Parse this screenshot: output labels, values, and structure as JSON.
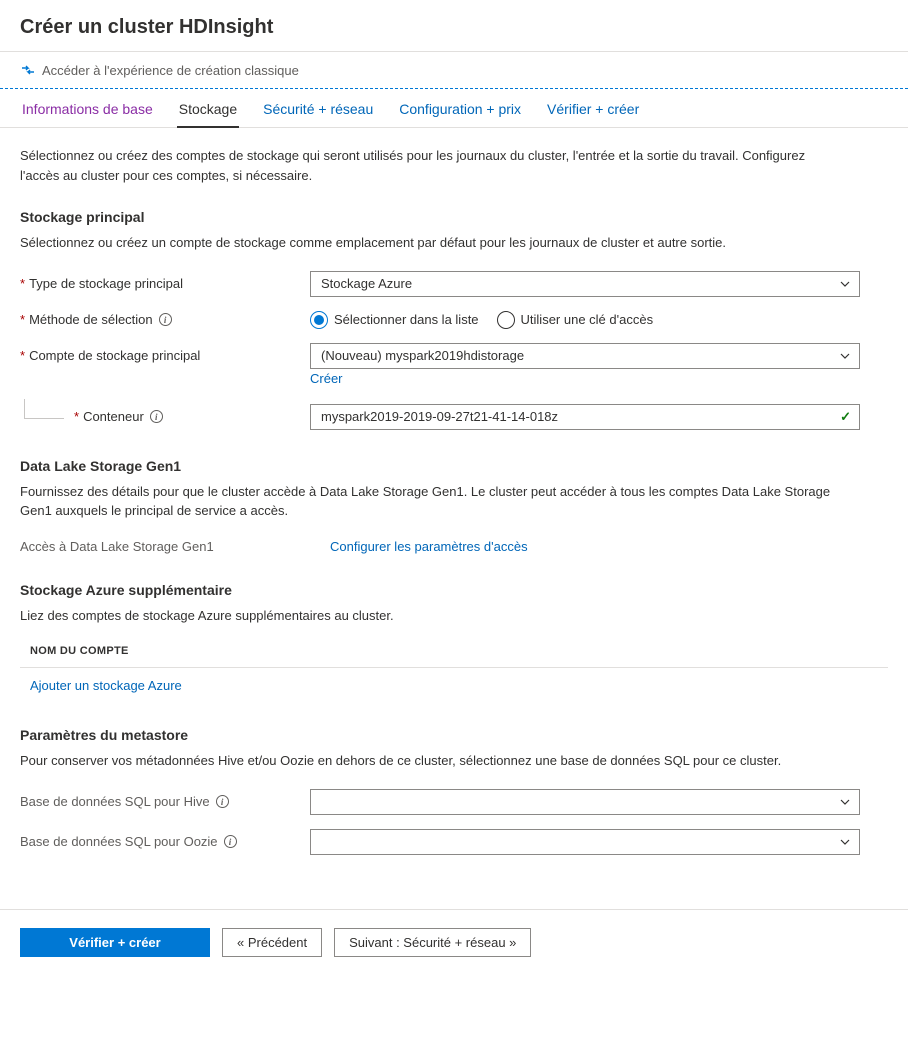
{
  "header": {
    "title": "Créer un cluster HDInsight"
  },
  "classic_link": {
    "text": "Accéder à l'expérience de création classique"
  },
  "tabs": [
    {
      "label": "Informations de base",
      "state": "visited"
    },
    {
      "label": "Stockage",
      "state": "active"
    },
    {
      "label": "Sécurité + réseau",
      "state": "link"
    },
    {
      "label": "Configuration + prix",
      "state": "link"
    },
    {
      "label": "Vérifier + créer",
      "state": "link"
    }
  ],
  "intro": "Sélectionnez ou créez des comptes de stockage qui seront utilisés pour les journaux du cluster, l'entrée et la sortie du travail. Configurez l'accès au cluster pour ces comptes, si nécessaire.",
  "primary_storage": {
    "title": "Stockage principal",
    "desc": "Sélectionnez ou créez un compte de stockage comme emplacement par défaut pour les journaux de cluster et autre sortie.",
    "type_label": "Type de stockage principal",
    "type_value": "Stockage Azure",
    "method_label": "Méthode de sélection",
    "method_options": [
      {
        "label": "Sélectionner dans la liste",
        "checked": true
      },
      {
        "label": "Utiliser une clé d'accès",
        "checked": false
      }
    ],
    "account_label": "Compte de stockage principal",
    "account_value": "(Nouveau) myspark2019hdistorage",
    "create_new": "Créer",
    "container_label": "Conteneur",
    "container_value": "myspark2019-2019-09-27t21-41-14-018z"
  },
  "adls": {
    "title": "Data Lake Storage Gen1",
    "desc": "Fournissez des détails pour que le cluster accède à Data Lake Storage Gen1. Le cluster peut accéder à tous les comptes Data Lake Storage Gen1 auxquels le principal de service a accès.",
    "access_label": "Accès à Data Lake Storage Gen1",
    "access_link": "Configurer les paramètres d'accès"
  },
  "additional": {
    "title": "Stockage Azure supplémentaire",
    "desc": "Liez des comptes de stockage Azure supplémentaires au cluster.",
    "col_header": "Nom du compte",
    "add_link": "Ajouter un stockage Azure"
  },
  "metastore": {
    "title": "Paramètres du metastore",
    "desc": "Pour conserver vos métadonnées Hive et/ou Oozie en dehors de ce cluster, sélectionnez une base de données SQL pour ce cluster.",
    "hive_label": "Base de données SQL pour Hive",
    "hive_value": "",
    "oozie_label": "Base de données SQL pour Oozie",
    "oozie_value": ""
  },
  "footer": {
    "review": "Vérifier + créer",
    "previous": "« Précédent",
    "next": "Suivant : Sécurité + réseau  »"
  }
}
